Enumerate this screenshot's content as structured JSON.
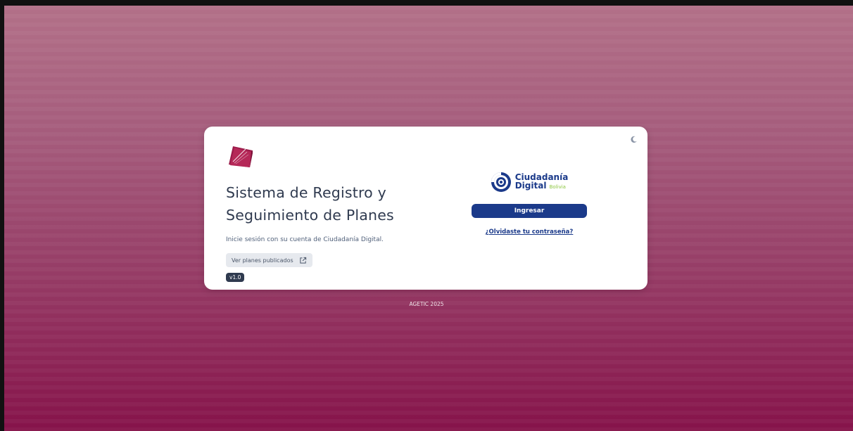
{
  "app": {
    "title_line1": "Sistema de Registro y",
    "title_line2": "Seguimiento de Planes",
    "subtitle": "Inicie sesión con su cuenta de Ciudadanía Digital.",
    "plans_button_label": "Ver planes publicados",
    "version": "v1.0"
  },
  "login": {
    "brand_line1": "Ciudadanía",
    "brand_line2": "Digital",
    "brand_suffix": "Bolivia",
    "login_button_label": "Ingresar",
    "forgot_link_label": "¿Olvidaste tu contraseña?"
  },
  "footer": {
    "text": "AGETIC 2025"
  },
  "icons": {
    "theme_toggle": "moon-icon",
    "app_logo": "book-logo-icon",
    "external_link": "external-link-icon",
    "brand_logo": "ciudadania-digital-logo-icon"
  },
  "colors": {
    "background_top": "#b27088",
    "background_bottom": "#86134a",
    "primary": "#1b3a8a",
    "accent_green": "#8cc63f",
    "book_logo": "#9b1b4a",
    "text_dark": "#2f3a4f"
  }
}
